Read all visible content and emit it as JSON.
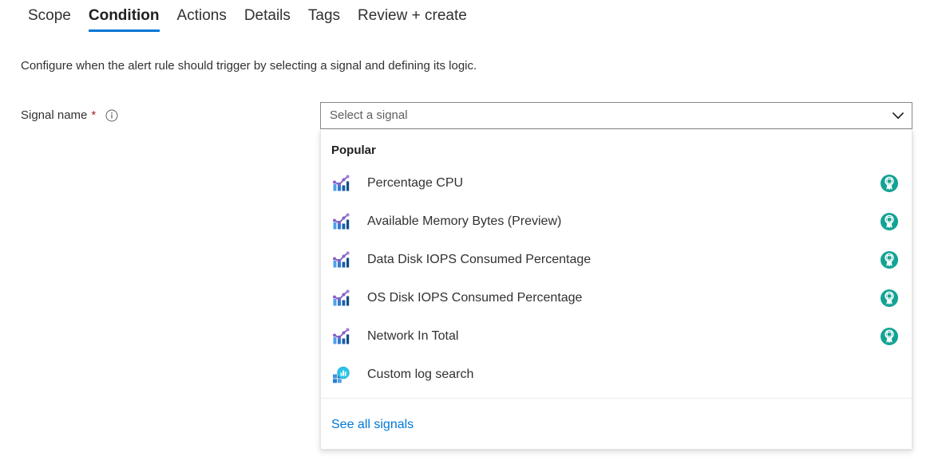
{
  "tabs": [
    {
      "label": "Scope",
      "selected": false
    },
    {
      "label": "Condition",
      "selected": true
    },
    {
      "label": "Actions",
      "selected": false
    },
    {
      "label": "Details",
      "selected": false
    },
    {
      "label": "Tags",
      "selected": false
    },
    {
      "label": "Review + create",
      "selected": false
    }
  ],
  "page": {
    "description": "Configure when the alert rule should trigger by selecting a signal and defining its logic."
  },
  "field": {
    "label": "Signal name",
    "required_marker": "*",
    "info_icon": "info-icon"
  },
  "combo": {
    "placeholder": "Select a signal",
    "value": "",
    "chevron_icon": "chevron-down-icon"
  },
  "dropdown": {
    "group_header": "Popular",
    "items": [
      {
        "label": "Percentage CPU",
        "icon": "metric-chart-icon",
        "badge": "popular-badge-icon",
        "has_badge": true
      },
      {
        "label": "Available Memory Bytes (Preview)",
        "icon": "metric-chart-icon",
        "badge": "popular-badge-icon",
        "has_badge": true
      },
      {
        "label": "Data Disk IOPS Consumed Percentage",
        "icon": "metric-chart-icon",
        "badge": "popular-badge-icon",
        "has_badge": true
      },
      {
        "label": "OS Disk IOPS Consumed Percentage",
        "icon": "metric-chart-icon",
        "badge": "popular-badge-icon",
        "has_badge": true
      },
      {
        "label": "Network In Total",
        "icon": "metric-chart-icon",
        "badge": "popular-badge-icon",
        "has_badge": true
      },
      {
        "label": "Custom log search",
        "icon": "log-search-icon",
        "badge": "",
        "has_badge": false
      }
    ],
    "footer_link": "See all signals"
  },
  "colors": {
    "accent": "#0078d4",
    "required": "#a4262c",
    "badge_teal": "#13a394",
    "text": "#323130",
    "placeholder": "#605e5c",
    "border": "#8a8886"
  }
}
